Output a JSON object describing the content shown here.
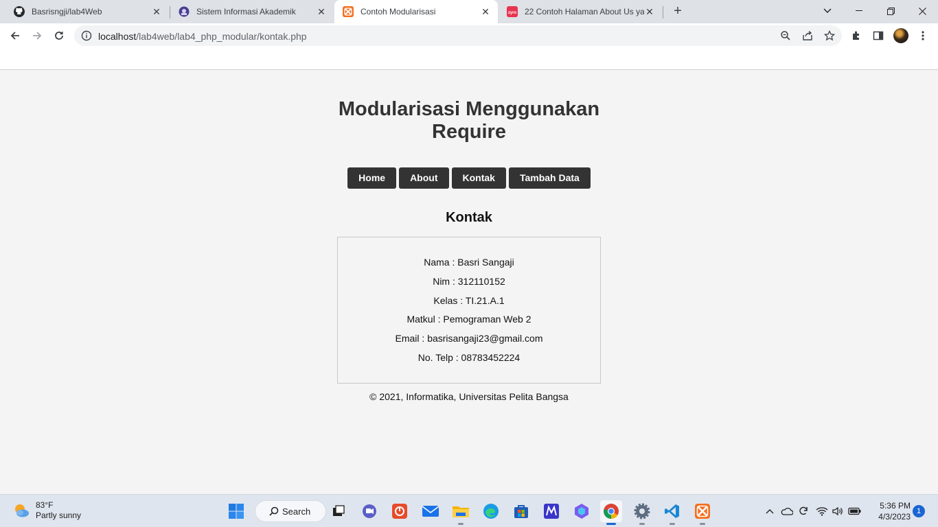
{
  "browser": {
    "tabs": [
      {
        "title": "Basrisngji/lab4Web",
        "favicon": "github-icon"
      },
      {
        "title": "Sistem Informasi Akademik",
        "favicon": "campus-icon"
      },
      {
        "title": "Contoh Modularisasi",
        "favicon": "xampp-icon",
        "active": true
      },
      {
        "title": "22 Contoh Halaman About Us ya",
        "favicon": "zyro-icon"
      }
    ],
    "url_host": "localhost",
    "url_path": "/lab4web/lab4_php_modular/kontak.php"
  },
  "page": {
    "title": "Modularisasi Menggunakan Require",
    "menu": [
      "Home",
      "About",
      "Kontak",
      "Tambah Data"
    ],
    "section_title": "Kontak",
    "contact": [
      "Nama : Basri Sangaji",
      "Nim : 312110152",
      "Kelas : TI.21.A.1",
      "Matkul : Pemograman Web 2",
      "Email : basrisangaji23@gmail.com",
      "No. Telp : 08783452224"
    ],
    "footer": "© 2021, Informatika, Universitas Pelita Bangsa"
  },
  "taskbar": {
    "weather_temp": "83°F",
    "weather_desc": "Partly sunny",
    "search_label": "Search",
    "time": "5:36 PM",
    "date": "4/3/2023",
    "notification_count": "1"
  },
  "colors": {
    "menu_bg": "#333333",
    "page_bg": "#f4f4f4",
    "taskbar_bg": "#dfe5ee",
    "accent": "#1a66d2"
  }
}
